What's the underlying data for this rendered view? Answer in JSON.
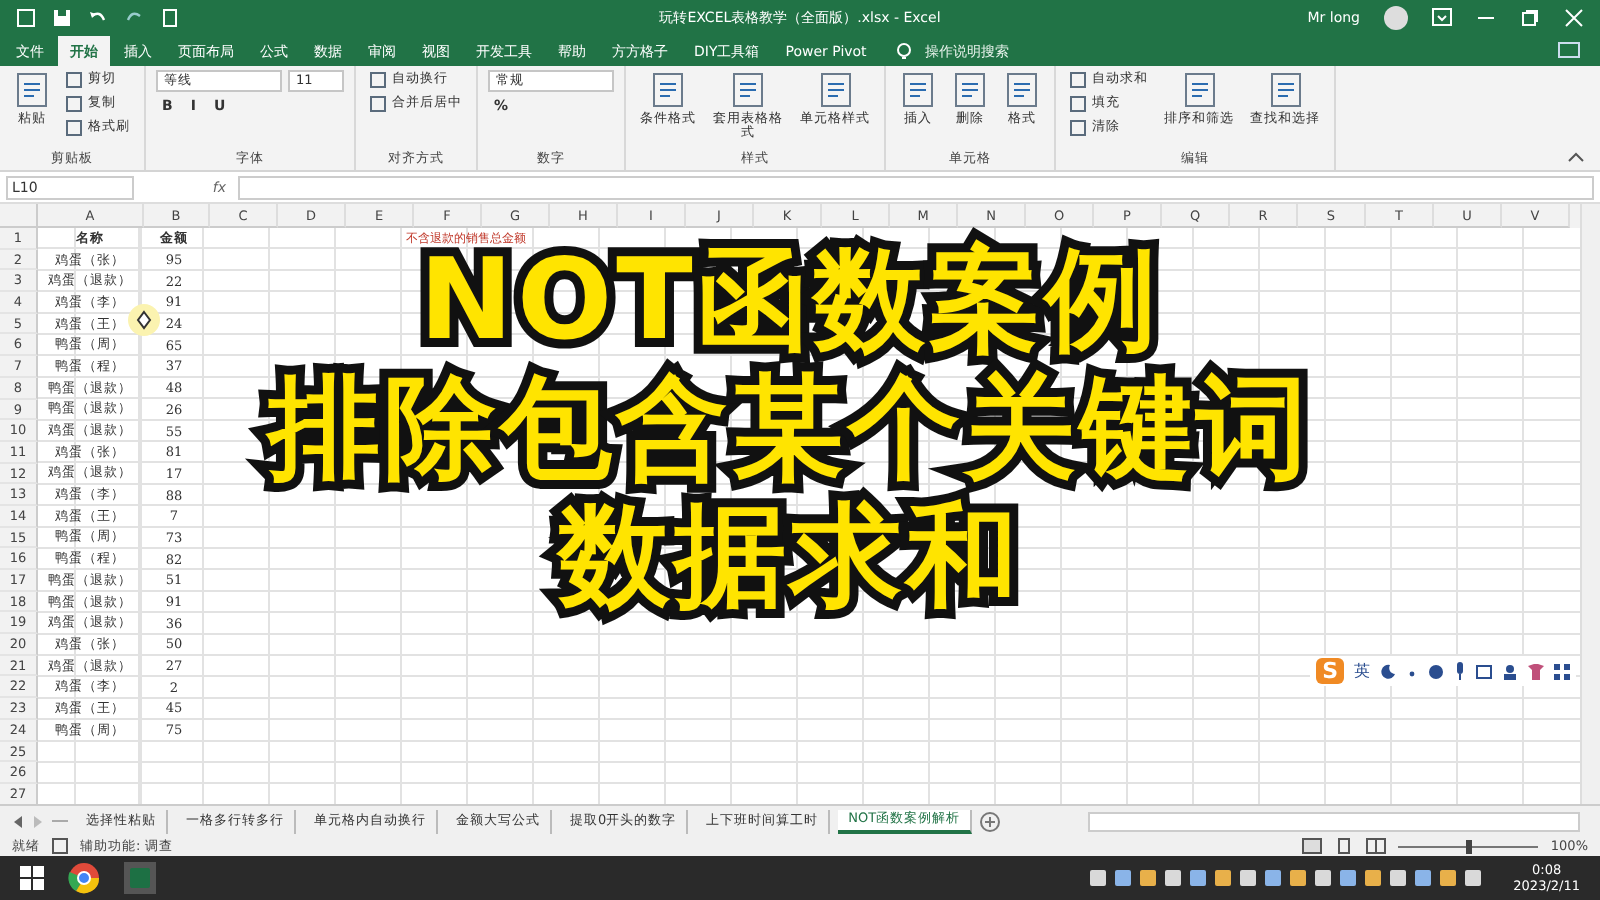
{
  "window": {
    "title": "玩转EXCEL表格教学（全面版）.xlsx  -  Excel",
    "user": "Mr long"
  },
  "ribbon_tabs": [
    {
      "label": "文件",
      "selected": false
    },
    {
      "label": "开始",
      "selected": true
    },
    {
      "label": "插入",
      "selected": false
    },
    {
      "label": "页面布局",
      "selected": false
    },
    {
      "label": "公式",
      "selected": false
    },
    {
      "label": "数据",
      "selected": false
    },
    {
      "label": "审阅",
      "selected": false
    },
    {
      "label": "视图",
      "selected": false
    },
    {
      "label": "开发工具",
      "selected": false
    },
    {
      "label": "帮助",
      "selected": false
    },
    {
      "label": "方方格子",
      "selected": false
    },
    {
      "label": "DIY工具箱",
      "selected": false
    },
    {
      "label": "Power Pivot",
      "selected": false
    }
  ],
  "tell_me": {
    "placeholder": "操作说明搜索"
  },
  "ribbon_groups": [
    {
      "label": "剪贴板",
      "items": [
        {
          "kind": "large",
          "label": "粘贴"
        },
        {
          "kind": "stack",
          "rows": [
            [
              {
                "kind": "small",
                "label": "剪切"
              }
            ],
            [
              {
                "kind": "small",
                "label": "复制"
              }
            ],
            [
              {
                "kind": "small",
                "label": "格式刷"
              }
            ]
          ]
        }
      ]
    },
    {
      "label": "字体",
      "items": [
        {
          "kind": "stack",
          "rows": [
            [
              {
                "kind": "field",
                "value": "等线"
              },
              {
                "kind": "field",
                "value": "11"
              }
            ],
            [
              {
                "kind": "glyph",
                "label": "B"
              },
              {
                "kind": "glyph",
                "label": "I"
              },
              {
                "kind": "glyph",
                "label": "U"
              }
            ]
          ]
        }
      ]
    },
    {
      "label": "对齐方式",
      "items": [
        {
          "kind": "stack",
          "rows": [
            [
              {
                "kind": "small",
                "label": "自动换行"
              }
            ],
            [
              {
                "kind": "small",
                "label": "合并后居中"
              }
            ]
          ]
        }
      ]
    },
    {
      "label": "数字",
      "items": [
        {
          "kind": "stack",
          "rows": [
            [
              {
                "kind": "field",
                "value": "常规"
              }
            ],
            [
              {
                "kind": "glyph",
                "label": "%"
              }
            ]
          ]
        }
      ]
    },
    {
      "label": "样式",
      "items": [
        {
          "kind": "large",
          "label": "条件格式"
        },
        {
          "kind": "large",
          "label": "套用表格格式"
        },
        {
          "kind": "large",
          "label": "单元格样式"
        }
      ]
    },
    {
      "label": "单元格",
      "items": [
        {
          "kind": "large",
          "label": "插入"
        },
        {
          "kind": "large",
          "label": "删除"
        },
        {
          "kind": "large",
          "label": "格式"
        }
      ]
    },
    {
      "label": "编辑",
      "items": [
        {
          "kind": "stack",
          "rows": [
            [
              {
                "kind": "small",
                "label": "自动求和"
              }
            ],
            [
              {
                "kind": "small",
                "label": "填充"
              }
            ],
            [
              {
                "kind": "small",
                "label": "清除"
              }
            ]
          ]
        },
        {
          "kind": "large",
          "label": "排序和筛选"
        },
        {
          "kind": "large",
          "label": "查找和选择"
        }
      ]
    }
  ],
  "formula_bar": {
    "name_box": "L10",
    "function_label": "fx"
  },
  "sheet": {
    "columns": [
      "A",
      "B",
      "C",
      "D",
      "E",
      "F",
      "G",
      "H",
      "I",
      "J",
      "K",
      "L",
      "M",
      "N",
      "O",
      "P",
      "Q",
      "R",
      "S",
      "T",
      "U",
      "V"
    ],
    "note": {
      "text": "不含退款的销售总金额"
    },
    "header_row": {
      "number": "1",
      "cells": [
        "名称",
        "金额"
      ]
    },
    "rows": [
      {
        "number": "2",
        "cells": [
          "鸡蛋（张）",
          "95"
        ]
      },
      {
        "number": "3",
        "cells": [
          "鸡蛋（退款）",
          "22"
        ]
      },
      {
        "number": "4",
        "cells": [
          "鸡蛋（李）",
          "91"
        ]
      },
      {
        "number": "5",
        "cells": [
          "鸡蛋（王）",
          "24"
        ]
      },
      {
        "number": "6",
        "cells": [
          "鸭蛋（周）",
          "65"
        ]
      },
      {
        "number": "7",
        "cells": [
          "鸭蛋（程）",
          "37"
        ]
      },
      {
        "number": "8",
        "cells": [
          "鸭蛋（退款）",
          "48"
        ]
      },
      {
        "number": "9",
        "cells": [
          "鸭蛋（退款）",
          "26"
        ]
      },
      {
        "number": "10",
        "cells": [
          "鸡蛋（退款）",
          "55"
        ]
      },
      {
        "number": "11",
        "cells": [
          "鸡蛋（张）",
          "81"
        ]
      },
      {
        "number": "12",
        "cells": [
          "鸡蛋（退款）",
          "17"
        ]
      },
      {
        "number": "13",
        "cells": [
          "鸡蛋（李）",
          "88"
        ]
      },
      {
        "number": "14",
        "cells": [
          "鸡蛋（王）",
          "7"
        ]
      },
      {
        "number": "15",
        "cells": [
          "鸭蛋（周）",
          "73"
        ]
      },
      {
        "number": "16",
        "cells": [
          "鸭蛋（程）",
          "82"
        ]
      },
      {
        "number": "17",
        "cells": [
          "鸭蛋（退款）",
          "51"
        ]
      },
      {
        "number": "18",
        "cells": [
          "鸭蛋（退款）",
          "91"
        ]
      },
      {
        "number": "19",
        "cells": [
          "鸡蛋（退款）",
          "36"
        ]
      },
      {
        "number": "20",
        "cells": [
          "鸡蛋（张）",
          "50"
        ]
      },
      {
        "number": "21",
        "cells": [
          "鸡蛋（退款）",
          "27"
        ]
      },
      {
        "number": "22",
        "cells": [
          "鸡蛋（李）",
          "2"
        ]
      },
      {
        "number": "23",
        "cells": [
          "鸡蛋（王）",
          "45"
        ]
      },
      {
        "number": "24",
        "cells": [
          "鸭蛋（周）",
          "75"
        ]
      },
      {
        "number": "25",
        "cells": []
      },
      {
        "number": "26",
        "cells": []
      },
      {
        "number": "27",
        "cells": []
      }
    ]
  },
  "overlay_title": [
    "NOT函数案例",
    "排除包含某个关键词",
    "数据求和"
  ],
  "ime_bar": {
    "logo": "S",
    "mode": "英"
  },
  "sheet_tabs": [
    {
      "label": "选择性粘贴",
      "selected": false
    },
    {
      "label": "一格多行转多行",
      "selected": false
    },
    {
      "label": "单元格内自动换行",
      "selected": false
    },
    {
      "label": "金额大写公式",
      "selected": false
    },
    {
      "label": "提取0开头的数字",
      "selected": false
    },
    {
      "label": "上下班时间算工时",
      "selected": false
    },
    {
      "label": "NOT函数案例解析",
      "selected": true
    }
  ],
  "status_bar": {
    "mode": "就绪",
    "accessibility": "辅助功能: 调查",
    "zoom": "100%",
    "level": 0.5
  },
  "taskbar": {
    "time": "0:08",
    "date": "2023/2/11"
  }
}
